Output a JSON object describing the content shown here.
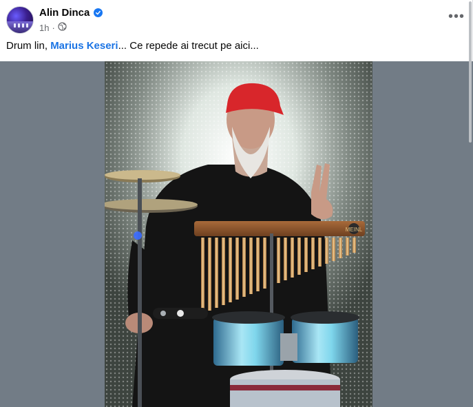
{
  "post": {
    "author": "Alin Dinca",
    "verified_icon": "verified-badge-icon",
    "timestamp": "1h",
    "separator": "·",
    "audience_icon": "globe-icon",
    "more_icon": "more-options-icon",
    "more_label": "•••",
    "caption": {
      "prefix": "Drum lin, ",
      "mention": "Marius Keseri",
      "suffix": "... Ce repede ai trecut pe aici..."
    }
  },
  "media": {
    "photo_icon": "post-photo",
    "chimes_brand": "MEINL"
  },
  "colors": {
    "accent": "#1b74e4",
    "verified": "#1877f2",
    "media_bg": "#727c86",
    "meta_text": "#65676b"
  }
}
